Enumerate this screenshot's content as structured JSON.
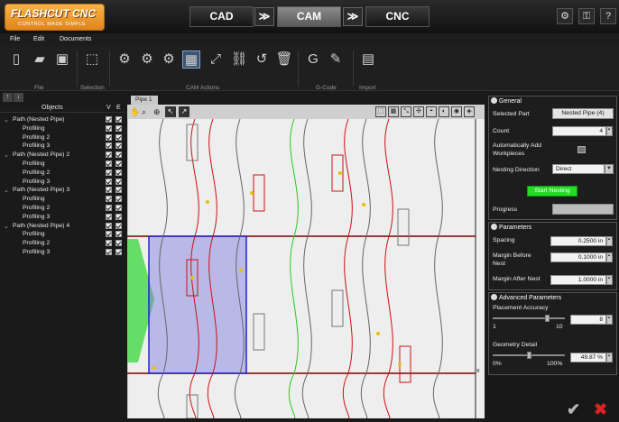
{
  "logo": {
    "title": "FLASHCUT CNC",
    "tagline": "CONTROL MADE SIMPLE"
  },
  "modes": [
    {
      "label": "CAD"
    },
    {
      "label": "CAM",
      "active": true
    },
    {
      "label": "CNC"
    }
  ],
  "mode_arrow": "≫",
  "top_icons": [
    "gear-icon",
    "key-icon",
    "help-icon"
  ],
  "menu": [
    "File",
    "Edit",
    "Documents"
  ],
  "ribbon": {
    "groups": [
      "File",
      "Selection",
      "CAM Actions",
      "G-Code",
      "Import"
    ],
    "icons": [
      "new-file-icon",
      "open-folder-icon",
      "save-icon",
      "select-icon",
      "settings-gear-icon",
      "path-settings-icon",
      "process-icon",
      "nest-icon",
      "expand-icon",
      "link-icon",
      "undo-icon",
      "delete-icon",
      "gcode-icon",
      "edit-icon",
      "import-icon"
    ]
  },
  "tree": {
    "header": {
      "objects": "Objects",
      "v": "V",
      "e": "E"
    },
    "rows": [
      {
        "label": "Path (Nested Pipe)",
        "level": 0
      },
      {
        "label": "Profiling",
        "level": 1
      },
      {
        "label": "Profiling 2",
        "level": 1
      },
      {
        "label": "Profiling 3",
        "level": 1
      },
      {
        "label": "Path (Nested Pipe) 2",
        "level": 0
      },
      {
        "label": "Profiling",
        "level": 1
      },
      {
        "label": "Profiling 2",
        "level": 1
      },
      {
        "label": "Profiling 3",
        "level": 1
      },
      {
        "label": "Path (Nested Pipe) 3",
        "level": 0
      },
      {
        "label": "Profiling",
        "level": 1
      },
      {
        "label": "Profiling 2",
        "level": 1
      },
      {
        "label": "Profiling 3",
        "level": 1
      },
      {
        "label": "Path (Nested Pipe) 4",
        "level": 0
      },
      {
        "label": "Profiling",
        "level": 1
      },
      {
        "label": "Profiling 2",
        "level": 1
      },
      {
        "label": "Profiling 3",
        "level": 1
      }
    ]
  },
  "canvas": {
    "tab_label": "Pipe 1",
    "axis_marker": "x"
  },
  "general": {
    "title": "General",
    "selected_part_label": "Selected Part",
    "selected_part_value": "Nested Pipe (4)",
    "count_label": "Count",
    "count_value": "4",
    "auto_add_label": "Automatically Add Workpieces",
    "nesting_direction_label": "Nesting Direction",
    "nesting_direction_value": "Direct",
    "start_button": "Start Nesting",
    "progress_label": "Progress"
  },
  "parameters": {
    "title": "Parameters",
    "spacing_label": "Spacing",
    "spacing_value": "0.2500 in",
    "margin_before_label": "Margin Before Nest",
    "margin_before_value": "0.1000 in",
    "margin_after_label": "Margin After Nest",
    "margin_after_value": "1.0000 in"
  },
  "advanced": {
    "title": "Advanced Parameters",
    "accuracy_label": "Placement Accuracy",
    "accuracy_min": "1",
    "accuracy_max": "10",
    "accuracy_value": "8",
    "geometry_label": "Geometry Detail",
    "geometry_min": "0%",
    "geometry_max": "100%",
    "geometry_value": "49.87 %"
  },
  "actions": {
    "ok": "✔",
    "cancel": "✖"
  },
  "colors": {
    "accent_green": "#22dd22",
    "cut_red": "#cc1111",
    "selection_blue": "#5555cc"
  }
}
